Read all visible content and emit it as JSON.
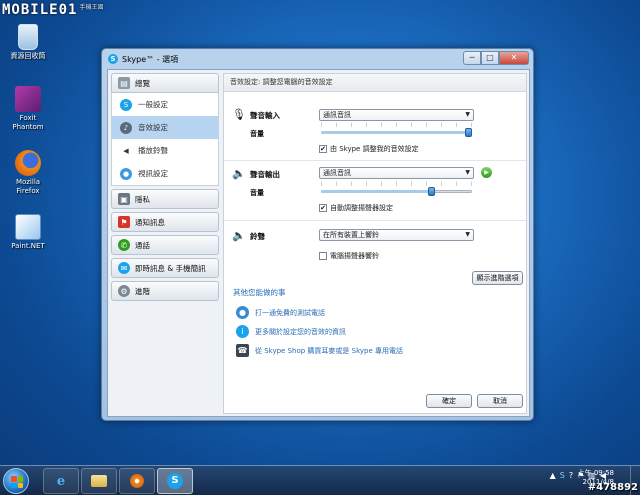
{
  "watermark": {
    "brand": "MOBILE01",
    "tag": "手機王國"
  },
  "desktop_icons": [
    {
      "label_line1": "資源回收筒",
      "label_line2": ""
    },
    {
      "label_line1": "Foxit",
      "label_line2": "Phantom"
    },
    {
      "label_line1": "Mozilla",
      "label_line2": "Firefox"
    },
    {
      "label_line1": "Paint.NET",
      "label_line2": ""
    }
  ],
  "window": {
    "title": "Skype™ - 選項",
    "buttons": {
      "min": "─",
      "max": "□",
      "close": "✕"
    }
  },
  "sidebar": {
    "general": {
      "label": "總覽"
    },
    "general_items": [
      {
        "label": "一般設定"
      },
      {
        "label": "音效設定"
      },
      {
        "label": "播放鈴聲"
      },
      {
        "label": "視訊設定"
      }
    ],
    "categories": [
      {
        "label": "隱私"
      },
      {
        "label": "通知訊息"
      },
      {
        "label": "通話"
      },
      {
        "label": "即時訊息 & 手機簡訊"
      },
      {
        "label": "進階"
      }
    ]
  },
  "content": {
    "header": "音效設定: 調整您電腦的音效設定",
    "mic": {
      "label": "聲音輸入",
      "device": "通訊音訊",
      "volume_label": "音量",
      "volume_level": 1.0,
      "auto_label": "由 Skype 調整我的音效設定",
      "auto_checked": "✔"
    },
    "speaker": {
      "label": "聲音輸出",
      "device": "通訊音訊",
      "volume_label": "音量",
      "volume_level": 0.74,
      "auto_label": "自動調整揚聲器設定",
      "auto_checked": "✔"
    },
    "ringing": {
      "label": "鈴聲",
      "device": "在所有裝置上響鈴",
      "pc_speaker_label": "電腦揚聲器響鈴",
      "pc_speaker_checked": ""
    },
    "advanced_button": "顯示進階選項",
    "links_header": "其他您能做的事",
    "links": [
      {
        "label": "打一通免費的測試電話"
      },
      {
        "label": "更多關於設定您的音效的資訊"
      },
      {
        "label": "從 Skype Shop 購買耳麥或是 Skype 專用電話"
      }
    ],
    "ok": "確定",
    "cancel": "取消"
  },
  "taskbar": {
    "clock_time": "上午 09:58",
    "clock_date": "2011/4/8"
  },
  "photo_id": "#478892",
  "colors": {
    "accent": "#2a6db5",
    "selected": "#b7d4f0"
  }
}
